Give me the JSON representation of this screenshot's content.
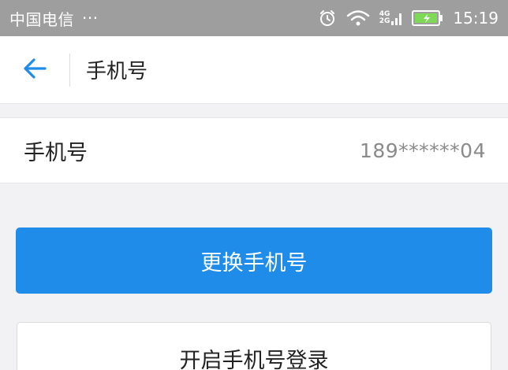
{
  "status_bar": {
    "carrier": "中国电信",
    "more": "···",
    "network_top": "4G",
    "network_bottom": "2G",
    "time": "15:19"
  },
  "header": {
    "title": "手机号"
  },
  "phone_row": {
    "label": "手机号",
    "value": "189******04"
  },
  "actions": {
    "change_phone": "更换手机号",
    "enable_phone_login": "开启手机号登录"
  },
  "colors": {
    "status_bar_bg": "#9e9e9e",
    "accent": "#1e8ce8",
    "back_arrow": "#1e8ce8",
    "page_bg": "#f2f2f4"
  },
  "icons": {
    "back": "arrow-left-icon",
    "alarm": "alarm-icon",
    "wifi": "wifi-icon",
    "signal": "signal-icon",
    "battery": "battery-charging-icon"
  }
}
